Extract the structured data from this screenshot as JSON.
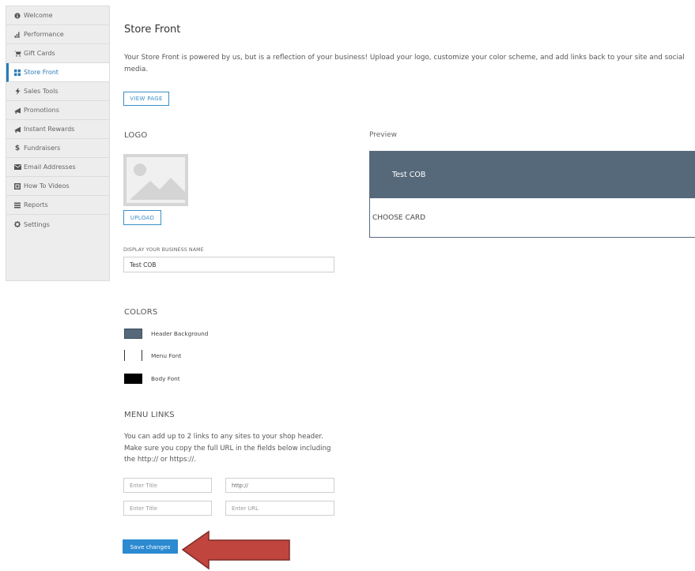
{
  "sidebar": {
    "items": [
      {
        "label": "Welcome",
        "icon": "info-circle-icon",
        "glyph": "❶"
      },
      {
        "label": "Performance",
        "icon": "bar-chart-icon",
        "glyph": "▁▃▅"
      },
      {
        "label": "Gift Cards",
        "icon": "cart-icon",
        "glyph": "▀"
      },
      {
        "label": "Store Front",
        "icon": "grid-icon",
        "glyph": "▦"
      },
      {
        "label": "Sales Tools",
        "icon": "lightning-icon",
        "glyph": "⚡"
      },
      {
        "label": "Promotions",
        "icon": "bullhorn-icon",
        "glyph": "◢"
      },
      {
        "label": "Instant Rewards",
        "icon": "bullhorn-icon",
        "glyph": "◢"
      },
      {
        "label": "Fundraisers",
        "icon": "dollar-icon",
        "glyph": "$"
      },
      {
        "label": "Email Addresses",
        "icon": "envelope-icon",
        "glyph": "✉"
      },
      {
        "label": "How To Videos",
        "icon": "video-icon",
        "glyph": "▣"
      },
      {
        "label": "Reports",
        "icon": "list-icon",
        "glyph": "☰"
      },
      {
        "label": "Settings",
        "icon": "gear-icon",
        "glyph": "✲"
      }
    ],
    "active_index": 3
  },
  "main": {
    "title": "Store Front",
    "intro": "Your Store Front is powered by us, but is a reflection of your business! Upload your logo, customize your color scheme, and add links back to your site and social media.",
    "view_page_label": "VIEW PAGE",
    "logo_label": "LOGO",
    "upload_label": "UPLOAD",
    "preview_label": "Preview",
    "preview_business_name": "Test COB",
    "preview_menu_item": "CHOOSE CARD",
    "business_name_label": "DISPLAY YOUR BUSINESS NAME",
    "business_name_value": "Test COB",
    "colors_label": "COLORS",
    "colors": [
      {
        "label": "Header Background",
        "hex": "#56697a"
      },
      {
        "label": "Menu Font",
        "hex": "#ffffff"
      },
      {
        "label": "Body Font",
        "hex": "#000000"
      }
    ],
    "menu_links_label": "MENU LINKS",
    "menu_links_text": "You can add up to 2 links to any sites to your shop header. Make sure you copy the full URL in the fields below including the http:// or https://.",
    "links": [
      {
        "title_placeholder": "Enter Title",
        "url_placeholder": "http://"
      },
      {
        "title_placeholder": "Enter Title",
        "url_placeholder": "Enter URL"
      }
    ],
    "save_label": "Save changes"
  },
  "accent_color": "#2c8ad1",
  "arrow_color": "#c0453f"
}
